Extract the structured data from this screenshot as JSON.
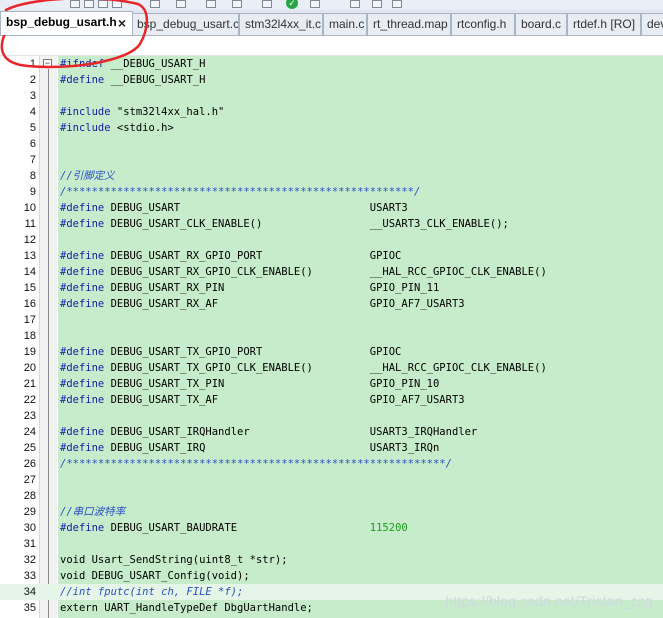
{
  "tabs": [
    {
      "label": "bsp_debug_usart.h",
      "active": true,
      "close": "×"
    },
    {
      "label": "bsp_debug_usart.c",
      "active": false
    },
    {
      "label": "stm32l4xx_it.c",
      "active": false
    },
    {
      "label": "main.c",
      "active": false
    },
    {
      "label": "rt_thread.map",
      "active": false
    },
    {
      "label": "rtconfig.h",
      "active": false
    },
    {
      "label": "board.c",
      "active": false
    },
    {
      "label": "rtdef.h [RO]",
      "active": false
    },
    {
      "label": "dev",
      "active": false
    }
  ],
  "lines": [
    {
      "n": "1",
      "a": "#ifndef",
      "b": " __DEBUG_USART_H"
    },
    {
      "n": "2",
      "a": "#define",
      "b": " __DEBUG_USART_H"
    },
    {
      "n": "3",
      "a": "",
      "b": ""
    },
    {
      "n": "4",
      "a": "#include",
      "b": " \"stm32l4xx_hal.h\""
    },
    {
      "n": "5",
      "a": "#include",
      "b": " <stdio.h>"
    },
    {
      "n": "6",
      "a": "",
      "b": ""
    },
    {
      "n": "7",
      "a": "",
      "b": ""
    },
    {
      "n": "8",
      "c": "//引脚定义"
    },
    {
      "n": "9",
      "c": "/*******************************************************/"
    },
    {
      "n": "10",
      "a": "#define",
      "b": " DEBUG_USART                              USART3"
    },
    {
      "n": "11",
      "a": "#define",
      "b": " DEBUG_USART_CLK_ENABLE()                 __USART3_CLK_ENABLE();"
    },
    {
      "n": "12",
      "a": "",
      "b": ""
    },
    {
      "n": "13",
      "a": "#define",
      "b": " DEBUG_USART_RX_GPIO_PORT                 GPIOC"
    },
    {
      "n": "14",
      "a": "#define",
      "b": " DEBUG_USART_RX_GPIO_CLK_ENABLE()         __HAL_RCC_GPIOC_CLK_ENABLE()"
    },
    {
      "n": "15",
      "a": "#define",
      "b": " DEBUG_USART_RX_PIN                       GPIO_PIN_11"
    },
    {
      "n": "16",
      "a": "#define",
      "b": " DEBUG_USART_RX_AF                        GPIO_AF7_USART3"
    },
    {
      "n": "17",
      "a": "",
      "b": ""
    },
    {
      "n": "18",
      "a": "",
      "b": ""
    },
    {
      "n": "19",
      "a": "#define",
      "b": " DEBUG_USART_TX_GPIO_PORT                 GPIOC"
    },
    {
      "n": "20",
      "a": "#define",
      "b": " DEBUG_USART_TX_GPIO_CLK_ENABLE()         __HAL_RCC_GPIOC_CLK_ENABLE()"
    },
    {
      "n": "21",
      "a": "#define",
      "b": " DEBUG_USART_TX_PIN                       GPIO_PIN_10"
    },
    {
      "n": "22",
      "a": "#define",
      "b": " DEBUG_USART_TX_AF                        GPIO_AF7_USART3"
    },
    {
      "n": "23",
      "a": "",
      "b": ""
    },
    {
      "n": "24",
      "a": "#define",
      "b": " DEBUG_USART_IRQHandler                   USART3_IRQHandler"
    },
    {
      "n": "25",
      "a": "#define",
      "b": " DEBUG_USART_IRQ                          USART3_IRQn"
    },
    {
      "n": "26",
      "c": "/************************************************************/"
    },
    {
      "n": "27",
      "a": "",
      "b": ""
    },
    {
      "n": "28",
      "a": "",
      "b": ""
    },
    {
      "n": "29",
      "c": "//串口波特率"
    },
    {
      "n": "30",
      "a": "#define",
      "b": " DEBUG_USART_BAUDRATE                     ",
      "num": "115200"
    },
    {
      "n": "31",
      "a": "",
      "b": ""
    },
    {
      "n": "32",
      "a": "",
      "b": "void Usart_SendString(uint8_t *str);"
    },
    {
      "n": "33",
      "a": "",
      "b": "void DEBUG_USART_Config(void);"
    },
    {
      "n": "34",
      "c": "//int fputc(int ch, FILE *f);",
      "cursor": true
    },
    {
      "n": "35",
      "a": "",
      "b": "extern UART_HandleTypeDef DbgUartHandle;"
    }
  ],
  "watermark": "https://blog.csdn.net/Tristan_csg",
  "colors": {
    "editor_bg": "#c7eccb",
    "keyword": "#1a1aa6",
    "comment": "#2a4fc4",
    "number": "#1b9e1b",
    "annotation": "#e8262a"
  }
}
